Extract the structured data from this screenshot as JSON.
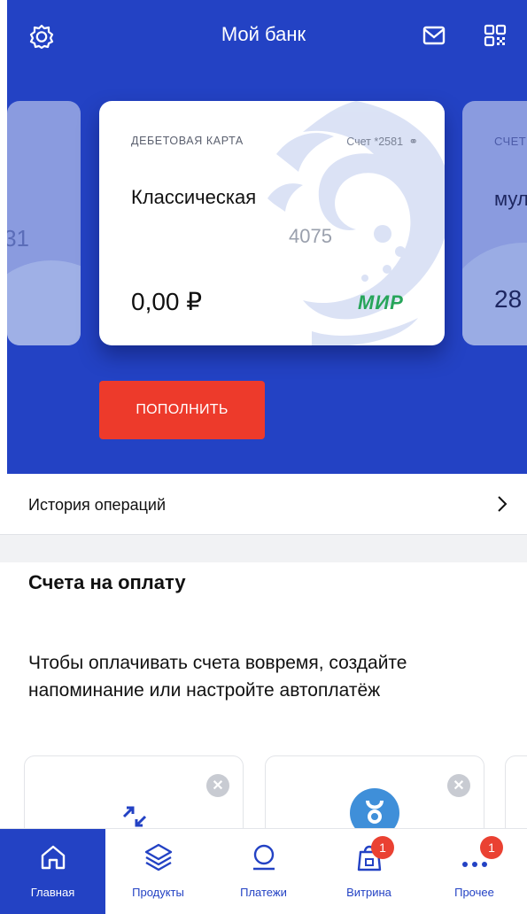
{
  "header": {
    "title": "Мой банк",
    "icons": [
      "gear-icon",
      "mail-icon",
      "qr-icon"
    ]
  },
  "cards": {
    "left": {
      "balance_fragment": "31"
    },
    "main": {
      "type_label": "ДЕБЕТОВАЯ КАРТА",
      "account_label": "Счет *2581",
      "name": "Классическая",
      "number": "4075",
      "balance": "0,00 ₽",
      "payment_system": "МИР"
    },
    "right": {
      "type_label": "СЧЕТ",
      "name": "мул",
      "balance_fragment": "28"
    }
  },
  "topup_button": "ПОПОЛНИТЬ",
  "history": {
    "label": "История операций"
  },
  "bills": {
    "title": "Счета на оплату",
    "description": "Чтобы оплачивать счета вовремя, создайте напоминание или настройте автоплатёж"
  },
  "nav": {
    "items": [
      {
        "label": "Главная",
        "icon": "home-icon",
        "active": true
      },
      {
        "label": "Продукты",
        "icon": "layers-icon"
      },
      {
        "label": "Платежи",
        "icon": "payments-icon"
      },
      {
        "label": "Витрина",
        "icon": "shopping-bag-icon",
        "badge": "1"
      },
      {
        "label": "Прочее",
        "icon": "more-icon",
        "badge": "1"
      }
    ]
  },
  "colors": {
    "brand_blue": "#2342c4",
    "accent_red": "#ed3a2b",
    "mir_green": "#27a55a"
  }
}
